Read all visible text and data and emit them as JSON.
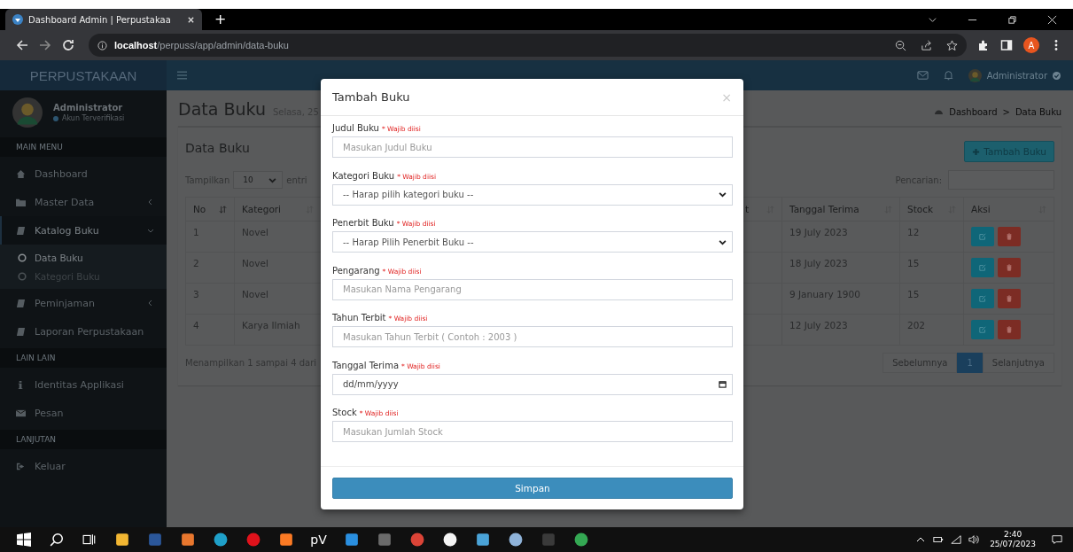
{
  "browser": {
    "tab_title": "Dashboard Admin | Perpustakaa",
    "new_tab": "+",
    "url": "**localhost**/perpuss/app/admin/data-buku",
    "profile": "A"
  },
  "app": {
    "brand": "PERPUSTAKAAN",
    "header_user": "Administrator",
    "user": {
      "name": "Administrator",
      "status": "Akun Terverifikasi"
    },
    "sidebar": [
      {
        "kind": "section",
        "label": "MAIN MENU"
      },
      {
        "kind": "item",
        "label": "Dashboard"
      },
      {
        "kind": "submenu",
        "label": "Master Data",
        "expanded": false
      },
      {
        "kind": "submenu",
        "label": "Katalog Buku",
        "expanded": true,
        "children": [
          {
            "label": "Data Buku",
            "selected": true
          },
          {
            "label": "Kategori Buku",
            "selected": false
          }
        ]
      },
      {
        "kind": "submenu",
        "label": "Peminjaman",
        "expanded": false
      },
      {
        "kind": "item",
        "label": "Laporan Perpustakaan"
      },
      {
        "kind": "section",
        "label": "LAIN LAIN"
      },
      {
        "kind": "item",
        "label": "Identitas Applikasi"
      },
      {
        "kind": "item",
        "label": "Pesan"
      },
      {
        "kind": "section",
        "label": "LANJUTAN"
      },
      {
        "kind": "item",
        "label": "Keluar"
      }
    ]
  },
  "page": {
    "title": "Data Buku",
    "date": "Selasa, 25",
    "breadcrumb": [
      "Dashboard",
      "Data Buku"
    ],
    "breadcrumb_separator": ">"
  },
  "card": {
    "title": "Data Buku",
    "add_button": "Tambah Buku",
    "length_label": "Tampilkan",
    "length_value": "10",
    "length_suffix": "entri",
    "search_label": "Pencarian:",
    "columns": [
      "No",
      "Kategori",
      "t",
      "Tanggal Terima",
      "Stock",
      "Aksi"
    ],
    "rows": [
      {
        "no": "1",
        "kategori": "Novel",
        "tanggal_terima": "19 July 2023",
        "stock": "12"
      },
      {
        "no": "2",
        "kategori": "Novel",
        "tanggal_terima": "18 July 2023",
        "stock": "15"
      },
      {
        "no": "3",
        "kategori": "Novel",
        "tanggal_terima": "9 January 1900",
        "stock": "15"
      },
      {
        "no": "4",
        "kategori": "Karya Ilmiah",
        "tanggal_terima": "12 July 2023",
        "stock": "202"
      }
    ],
    "info": "Menampilkan 1 sampai 4 dari",
    "pagination": {
      "prev": "Sebelumnya",
      "pages": [
        {
          "label": "1",
          "selected": true
        }
      ],
      "next": "Selanjutnya"
    }
  },
  "modal": {
    "title": "Tambah Buku",
    "close": "×",
    "submit": "Simpan",
    "fields": [
      {
        "label": "Judul Buku",
        "required": "* Wajib diisi",
        "kind": "text",
        "placeholder": "Masukan Judul Buku"
      },
      {
        "label": "Kategori Buku",
        "required": "* Wajib diisi",
        "kind": "select",
        "value": "-- Harap pilih kategori buku --"
      },
      {
        "label": "Penerbit Buku",
        "required": "* Wajib diisi",
        "kind": "select",
        "value": "-- Harap Pilih Penerbit Buku --"
      },
      {
        "label": "Pengarang",
        "required": "* Wajib diisi",
        "kind": "text",
        "placeholder": "Masukan Nama Pengarang"
      },
      {
        "label": "Tahun Terbit",
        "required": "* Wajib diisi",
        "kind": "text",
        "placeholder": "Masukan Tahun Terbit ( Contoh : 2003 )"
      },
      {
        "label": "Tanggal Terima",
        "required": "* Wajib diisi",
        "kind": "date",
        "placeholder": "dd/mm/yyyy"
      },
      {
        "label": "Stock",
        "required": "* Wajib diisi",
        "kind": "text",
        "placeholder": "Masukan Jumlah Stock"
      }
    ]
  },
  "taskbar": {
    "apps": [
      {
        "kind": "windows"
      },
      {
        "kind": "search"
      },
      {
        "kind": "taskview"
      },
      {
        "kind": "tile",
        "color": "#f2b632"
      },
      {
        "kind": "tile",
        "color": "#2b579a"
      },
      {
        "kind": "tile",
        "color": "#e8772e"
      },
      {
        "kind": "round",
        "color": "#1fa0c9"
      },
      {
        "kind": "round",
        "color": "#e0121b"
      },
      {
        "kind": "tile",
        "color": "#fb7a24"
      },
      {
        "kind": "text",
        "label": "pV"
      },
      {
        "kind": "tile",
        "color": "#2a8fe0"
      },
      {
        "kind": "tile",
        "color": "#6b6b6b"
      },
      {
        "kind": "round",
        "color": "#db4437"
      },
      {
        "kind": "round",
        "color": "#f4f4f4"
      },
      {
        "kind": "tile",
        "color": "#4aa3d8"
      },
      {
        "kind": "round",
        "color": "#8fb3d9"
      },
      {
        "kind": "tile",
        "color": "#3a3a3a"
      },
      {
        "kind": "round",
        "color": "#34a853"
      }
    ],
    "time": "2:40",
    "date": "25/07/2023"
  }
}
